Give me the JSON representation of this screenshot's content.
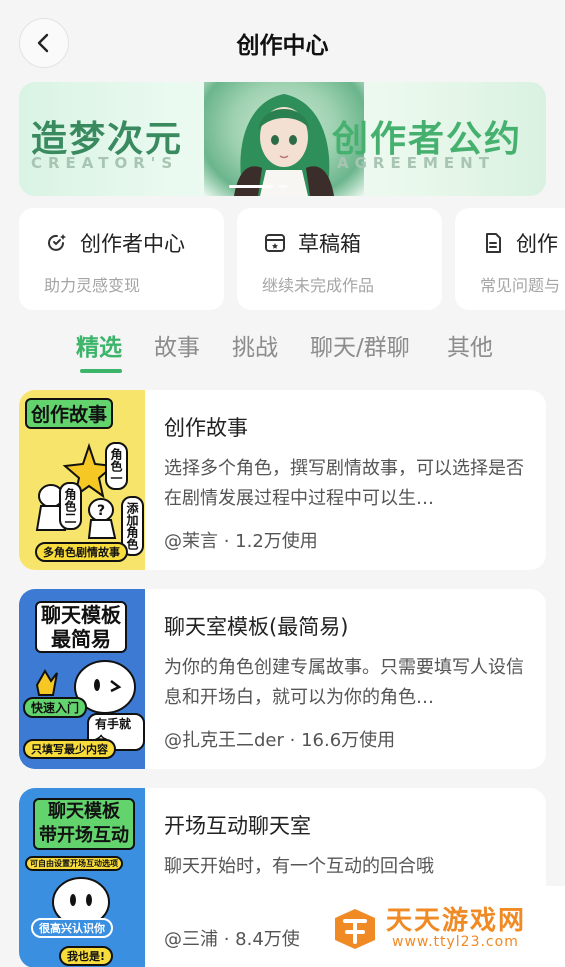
{
  "header": {
    "title": "创作中心"
  },
  "banner": {
    "title_left": "造梦次元",
    "title_right": "创作者公约",
    "sub_left": "CREATOR'S",
    "sub_right": "AGREEMENT"
  },
  "quick_cards": [
    {
      "icon": "sparkle-cycle-icon",
      "title": "创作者中心",
      "subtitle": "助力灵感变现"
    },
    {
      "icon": "draft-box-icon",
      "title": "草稿箱",
      "subtitle": "继续未完成作品"
    },
    {
      "icon": "document-icon",
      "title": "创作",
      "subtitle": "常见问题与"
    }
  ],
  "tabs": [
    "精选",
    "故事",
    "挑战",
    "聊天/群聊",
    "其他"
  ],
  "active_tab": "精选",
  "items": [
    {
      "title": "创作故事",
      "description": "选择多个角色，撰写剧情故事，可以选择是否在剧情发展过程中过程中可以生…",
      "meta": "@茉言 · 1.2万使用",
      "thumb": {
        "headline": "创作故事",
        "tag1": "角色一",
        "tag2": "角色二",
        "tag3": "添加角色",
        "footer": "多角色剧情故事"
      }
    },
    {
      "title": "聊天室模板(最简易)",
      "description": "为你的角色创建专属故事。只需要填写人设信息和开场白，就可以为你的角色…",
      "meta": "@扎克王二der · 16.6万使用",
      "thumb": {
        "headline": "聊天模板",
        "headline2": "最简易",
        "tag1": "快速入门",
        "tag2": "有手就会",
        "footer": "只填写最少内容"
      }
    },
    {
      "title": "开场互动聊天室",
      "description": "聊天开始时，有一个互动的回合哦",
      "meta": "@三浦 · 8.4万使",
      "thumb": {
        "headline": "聊天模板",
        "headline2": "带开场互动",
        "tag1": "可自由设置开场互动选项",
        "tag2": "很高兴认识你",
        "footer": "我也是!"
      }
    }
  ],
  "watermark": {
    "name": "天天游戏网",
    "url": "www.ttyl23.com"
  },
  "colors": {
    "accent": "#3cb46a",
    "background": "#f5f5f5",
    "watermark": "#f08a24"
  }
}
